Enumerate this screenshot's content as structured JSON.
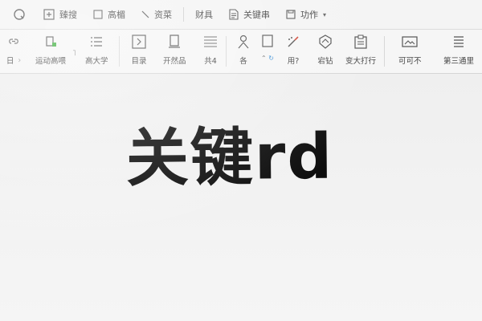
{
  "menubar": {
    "items": [
      {
        "label": "",
        "icon": "circle-q-icon"
      },
      {
        "label": "臻搜",
        "icon": "plus-box-icon"
      },
      {
        "label": "高楣",
        "icon": "frame-icon"
      },
      {
        "label": "资菜",
        "icon": "diagonal-icon"
      },
      {
        "label": "财具",
        "icon": ""
      },
      {
        "label": "关键串",
        "icon": "doc-icon"
      },
      {
        "label": "功作",
        "icon": "save-icon"
      }
    ]
  },
  "ribbon": {
    "breadcrumb": [
      "日",
      "运动高喂",
      "高大学"
    ],
    "buttons": [
      {
        "label": "目录",
        "icon": "arrow-box-icon"
      },
      {
        "label": "开然品",
        "icon": "page-icon"
      },
      {
        "label": "共4",
        "icon": "lines-icon"
      },
      {
        "label": "各",
        "icon": "person-icon"
      },
      {
        "label": "用?",
        "icon": "brush-icon"
      },
      {
        "label": "宕钻",
        "icon": "shield-icon"
      },
      {
        "label": "变大打行",
        "icon": "clipboard-icon"
      },
      {
        "label": "可可不",
        "icon": "image-icon"
      },
      {
        "label": "第三通里",
        "icon": "stack-icon"
      }
    ]
  },
  "document": {
    "heading": "关键rd"
  }
}
